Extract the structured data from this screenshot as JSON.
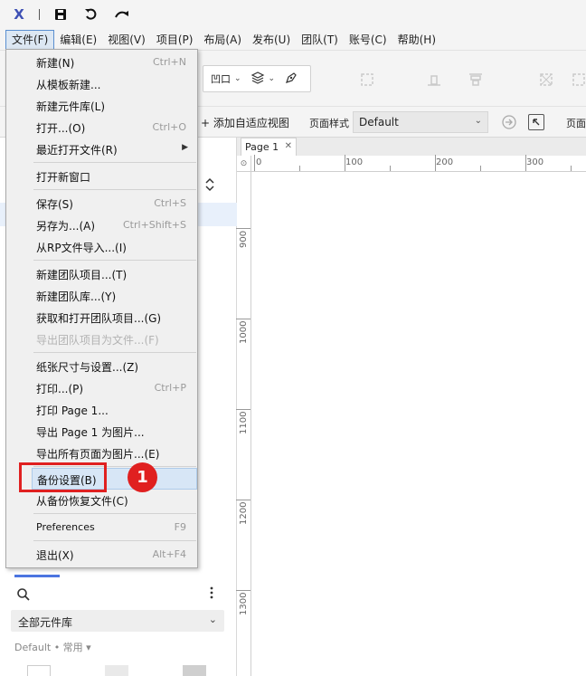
{
  "app": {
    "logo": "X"
  },
  "titlebar": {
    "icons": [
      "save-icon",
      "undo-icon",
      "redo-icon"
    ]
  },
  "menubar": {
    "items": [
      {
        "label": "文件(F)",
        "active": true
      },
      {
        "label": "编辑(E)"
      },
      {
        "label": "视图(V)"
      },
      {
        "label": "项目(P)"
      },
      {
        "label": "布局(A)"
      },
      {
        "label": "发布(U)"
      },
      {
        "label": "团队(T)"
      },
      {
        "label": "账号(C)"
      },
      {
        "label": "帮助(H)"
      }
    ]
  },
  "toolbar": {
    "group_label": "凹口"
  },
  "toolbar2": {
    "add_view": "+ 添加自适应视图",
    "page_style_label": "页面样式",
    "page_style_value": "Default",
    "page_style_label2": "页面对"
  },
  "file_menu": {
    "items": [
      {
        "label": "新建(N)",
        "shortcut": "Ctrl+N"
      },
      {
        "label": "从模板新建..."
      },
      {
        "label": "新建元件库(L)"
      },
      {
        "label": "打开...(O)",
        "shortcut": "Ctrl+O"
      },
      {
        "label": "最近打开文件(R)",
        "submenu": "▶"
      },
      {
        "label": "打开新窗口"
      },
      {
        "label": "保存(S)",
        "shortcut": "Ctrl+S"
      },
      {
        "label": "另存为...(A)",
        "shortcut": "Ctrl+Shift+S"
      },
      {
        "label": "从RP文件导入...(I)"
      },
      {
        "label": "新建团队项目...(T)"
      },
      {
        "label": "新建团队库...(Y)"
      },
      {
        "label": "获取和打开团队项目...(G)"
      },
      {
        "label": "导出团队项目为文件...(F)",
        "disabled": true
      },
      {
        "label": "纸张尺寸与设置...(Z)"
      },
      {
        "label": "打印...(P)",
        "shortcut": "Ctrl+P"
      },
      {
        "label": "打印 Page 1..."
      },
      {
        "label": "导出 Page 1 为图片..."
      },
      {
        "label": "导出所有页面为图片...(E)"
      },
      {
        "label": "备份设置(B)",
        "highlighted": true
      },
      {
        "label": "从备份恢复文件(C)"
      },
      {
        "label": "Preferences",
        "shortcut": "F9"
      },
      {
        "label": "退出(X)",
        "shortcut": "Alt+F4"
      }
    ]
  },
  "callout": {
    "number": "1",
    "color": "#e02020"
  },
  "canvas": {
    "page_tab": "Page 1",
    "ruler_top": [
      "0",
      "100",
      "200",
      "300"
    ],
    "ruler_left": [
      "900",
      "1000",
      "1100",
      "1200",
      "1300"
    ]
  },
  "left_panel": {
    "library_select": "全部元件库",
    "library_filter": "Default • 常用 ▾"
  },
  "colors": {
    "accent": "#4b74e0",
    "menu_highlight": "#d7e6f6",
    "callout": "#e02020"
  }
}
